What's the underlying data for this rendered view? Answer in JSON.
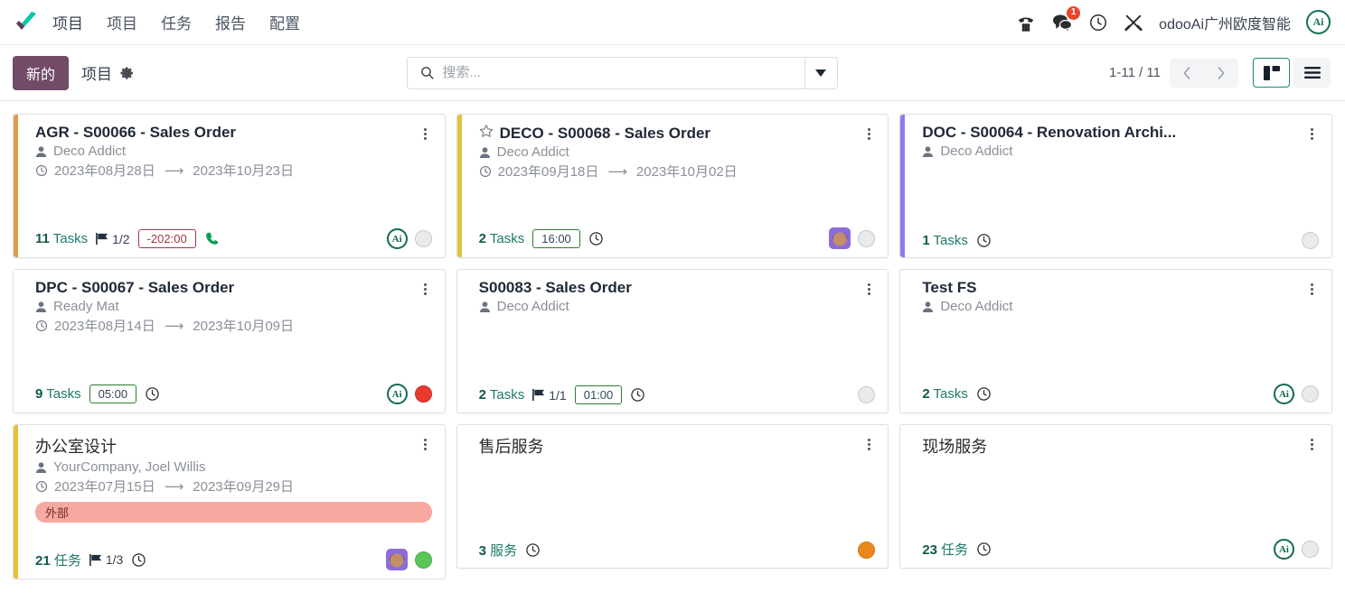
{
  "navbar": {
    "app_title": "项目",
    "menu": [
      {
        "label": "项目"
      },
      {
        "label": "任务"
      },
      {
        "label": "报告"
      },
      {
        "label": "配置"
      }
    ],
    "icons": {
      "dialpad": "phone-dialpad-icon",
      "messages": "chat-icon",
      "activities": "clock-icon",
      "tools": "tools-icon"
    },
    "message_badge": "1",
    "user_name": "odooAi广州欧度智能",
    "user_avatar_text": "Ai"
  },
  "control_panel": {
    "new_button": "新的",
    "breadcrumb": "项目",
    "gear": "gear-icon",
    "search_placeholder": "搜索...",
    "search_value": "",
    "pager": "1-11 / 11",
    "view_kanban": "kanban-view-icon",
    "view_list": "list-view-icon"
  },
  "colors": {
    "brand_purple": "#714B67",
    "teal": "#1C8878",
    "stripe_orange": "#E09B4D",
    "stripe_yellow": "#E5C03C",
    "stripe_purple": "#8E7BEF",
    "badge_red": "#A03A46",
    "badge_green": "#2E7D32",
    "tag_pink": "#F7A8A0"
  },
  "cards": [
    {
      "title": "AGR - S00066 - Sales Order",
      "starred": false,
      "stripe": "#E09B4D",
      "customer": "Deco Addict",
      "date_start": "2023年08月28日",
      "date_end": "2023年10月23日",
      "tag": "",
      "tasks_count": "11",
      "tasks_label": "Tasks",
      "flag": "1/2",
      "time_badge": "-202:00",
      "time_badge_style": "neg",
      "show_clock": false,
      "show_phone": true,
      "avatar": "ai",
      "status": "gray"
    },
    {
      "title": "DECO - S00068 - Sales Order",
      "starred": true,
      "stripe": "#E5C03C",
      "customer": "Deco Addict",
      "date_start": "2023年09月18日",
      "date_end": "2023年10月02日",
      "tag": "",
      "tasks_count": "2",
      "tasks_label": "Tasks",
      "flag": "",
      "time_badge": "16:00",
      "time_badge_style": "pos",
      "show_clock": true,
      "show_phone": false,
      "avatar": "photo",
      "status": "gray"
    },
    {
      "title": "DOC - S00064 - Renovation Archi...",
      "starred": false,
      "stripe": "#8E7BEF",
      "customer": "Deco Addict",
      "date_start": "",
      "date_end": "",
      "tag": "",
      "tasks_count": "1",
      "tasks_label": "Tasks",
      "flag": "",
      "time_badge": "",
      "time_badge_style": "",
      "show_clock": true,
      "show_phone": false,
      "avatar": "none",
      "status": "gray"
    },
    {
      "title": "DPC - S00067 - Sales Order",
      "starred": false,
      "stripe": "",
      "customer": "Ready Mat",
      "date_start": "2023年08月14日",
      "date_end": "2023年10月09日",
      "tag": "",
      "tasks_count": "9",
      "tasks_label": "Tasks",
      "flag": "",
      "time_badge": "05:00",
      "time_badge_style": "pos",
      "show_clock": true,
      "show_phone": false,
      "avatar": "ai",
      "status": "red"
    },
    {
      "title": "S00083 - Sales Order",
      "starred": false,
      "stripe": "",
      "customer": "Deco Addict",
      "date_start": "",
      "date_end": "",
      "tag": "",
      "tasks_count": "2",
      "tasks_label": "Tasks",
      "flag": "1/1",
      "time_badge": "01:00",
      "time_badge_style": "pos",
      "show_clock": true,
      "show_phone": false,
      "avatar": "none",
      "status": "gray"
    },
    {
      "title": "Test FS",
      "starred": false,
      "stripe": "",
      "customer": "Deco Addict",
      "date_start": "",
      "date_end": "",
      "tag": "",
      "tasks_count": "2",
      "tasks_label": "Tasks",
      "flag": "",
      "time_badge": "",
      "time_badge_style": "",
      "show_clock": true,
      "show_phone": false,
      "avatar": "ai",
      "status": "gray"
    },
    {
      "title": "办公室设计",
      "starred": false,
      "stripe": "#E5C03C",
      "customer": "YourCompany, Joel Willis",
      "date_start": "2023年07月15日",
      "date_end": "2023年09月29日",
      "tag": "外部",
      "tasks_count": "21",
      "tasks_label": "任务",
      "flag": "1/3",
      "time_badge": "",
      "time_badge_style": "",
      "show_clock": true,
      "show_phone": false,
      "avatar": "photo",
      "status": "green"
    },
    {
      "title": "售后服务",
      "starred": false,
      "stripe": "",
      "customer": "",
      "date_start": "",
      "date_end": "",
      "tag": "",
      "tasks_count": "3",
      "tasks_label": "服务",
      "flag": "",
      "time_badge": "",
      "time_badge_style": "",
      "show_clock": true,
      "show_phone": false,
      "avatar": "none",
      "status": "orange"
    },
    {
      "title": "现场服务",
      "starred": false,
      "stripe": "",
      "customer": "",
      "date_start": "",
      "date_end": "",
      "tag": "",
      "tasks_count": "23",
      "tasks_label": "任务",
      "flag": "",
      "time_badge": "",
      "time_badge_style": "",
      "show_clock": true,
      "show_phone": false,
      "avatar": "ai",
      "status": "gray"
    }
  ]
}
